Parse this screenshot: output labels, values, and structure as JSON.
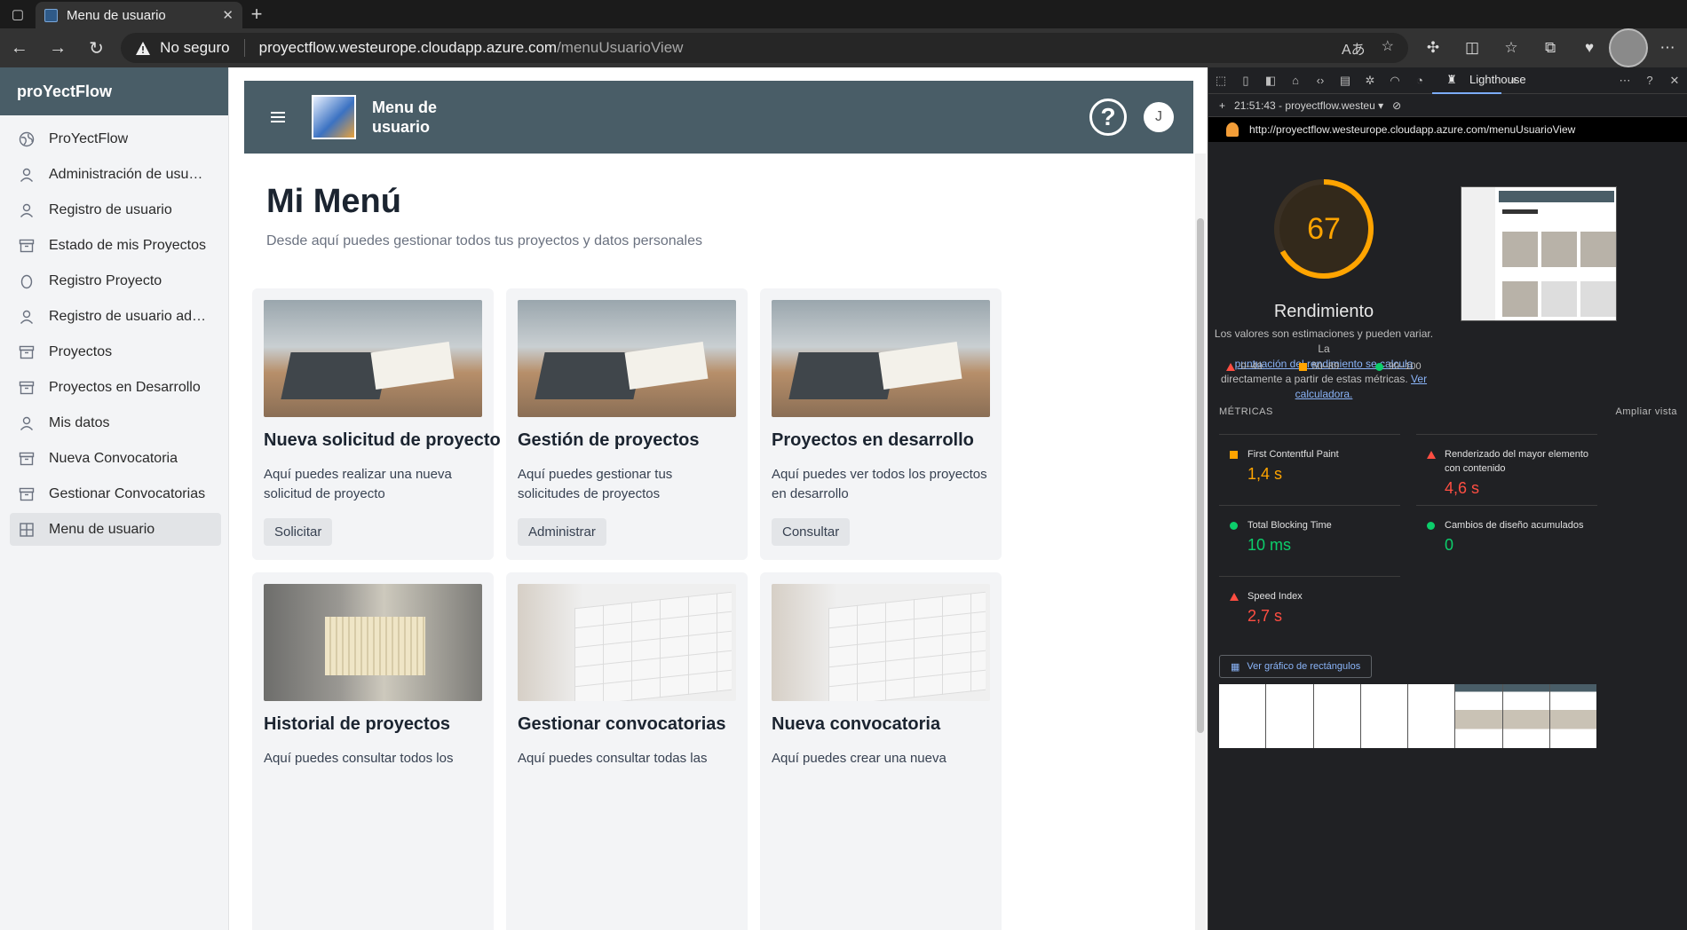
{
  "browser": {
    "tab_title": "Menu de usuario",
    "security_label": "No seguro",
    "url_host": "proyectflow.westeurope.cloudapp.azure.com",
    "url_path": "/menuUsuarioView"
  },
  "sidebar": {
    "brand": "proYectFlow",
    "items": [
      {
        "label": "ProYectFlow",
        "icon": "globe-icon"
      },
      {
        "label": "Administración de usuarios",
        "icon": "user-icon"
      },
      {
        "label": "Registro de usuario",
        "icon": "user-icon"
      },
      {
        "label": "Estado de mis Proyectos",
        "icon": "archive-icon"
      },
      {
        "label": "Registro Proyecto",
        "icon": "egg-icon"
      },
      {
        "label": "Registro de usuario administrador",
        "icon": "user-icon"
      },
      {
        "label": "Proyectos",
        "icon": "archive-icon"
      },
      {
        "label": "Proyectos en Desarrollo",
        "icon": "archive-icon"
      },
      {
        "label": "Mis datos",
        "icon": "user-icon"
      },
      {
        "label": "Nueva Convocatoria",
        "icon": "archive-icon"
      },
      {
        "label": "Gestionar Convocatorias",
        "icon": "archive-icon"
      },
      {
        "label": "Menu de usuario",
        "icon": "grid-icon",
        "active": true
      }
    ]
  },
  "header": {
    "title": "Menu de usuario",
    "user_initial": "J",
    "help_icon": "help-circle-icon"
  },
  "main": {
    "title": "Mi Menú",
    "subtitle": "Desde aquí puedes gestionar todos tus proyectos y datos personales",
    "cards": [
      {
        "title": "Nueva solicitud de proyecto",
        "description": "Aquí puedes realizar una nueva solicitud de proyecto",
        "button": "Solicitar",
        "image": "laptop-photo"
      },
      {
        "title": "Gestión de proyectos",
        "description": "Aquí puedes gestionar tus solicitudes de proyectos",
        "button": "Administrar",
        "image": "laptop-photo"
      },
      {
        "title": "Proyectos en desarrollo",
        "description": "Aquí puedes ver todos los proyectos en desarrollo",
        "button": "Consultar",
        "image": "laptop-photo"
      },
      {
        "title": "Historial de proyectos",
        "description": "Aquí puedes consultar todos los",
        "image": "file-cabinet-photo"
      },
      {
        "title": "Gestionar convocatorias",
        "description": "Aquí puedes consultar todas las",
        "image": "calendar-photo"
      },
      {
        "title": "Nueva convocatoria",
        "description": "Aquí puedes crear una nueva",
        "image": "calendar-photo"
      }
    ]
  },
  "devtools": {
    "active_tab": "Lighthouse",
    "report_selector": "21:51:43 - proyectflow.westeu",
    "report_url": "http://proyectflow.westeurope.cloudapp.azure.com/menuUsuarioView",
    "score": 67,
    "score_fraction": 0.67,
    "category": "Rendimiento",
    "note_1": "Los valores son estimaciones y pueden variar. La",
    "note_link": "puntuación del rendimiento se calcula",
    "note_2": "directamente a partir de estas métricas.",
    "note_calc": "Ver calculadora.",
    "legend": [
      "0–49",
      "50–89",
      "90–100"
    ],
    "metrics_label": "MÉTRICAS",
    "expand_label": "Ampliar vista",
    "metrics": [
      {
        "name": "First Contentful Paint",
        "value": "1,4 s",
        "rating": "orange"
      },
      {
        "name": "Renderizado del mayor elemento con contenido",
        "value": "4,6 s",
        "rating": "red"
      },
      {
        "name": "Total Blocking Time",
        "value": "10 ms",
        "rating": "green"
      },
      {
        "name": "Cambios de diseño acumulados",
        "value": "0",
        "rating": "green"
      },
      {
        "name": "Speed Index",
        "value": "2,7 s",
        "rating": "red"
      }
    ],
    "treemap_label": "Ver gráfico de rectángulos",
    "colors": {
      "orange": "#ffa400",
      "red": "#ff4e42",
      "green": "#0cce6b"
    }
  }
}
